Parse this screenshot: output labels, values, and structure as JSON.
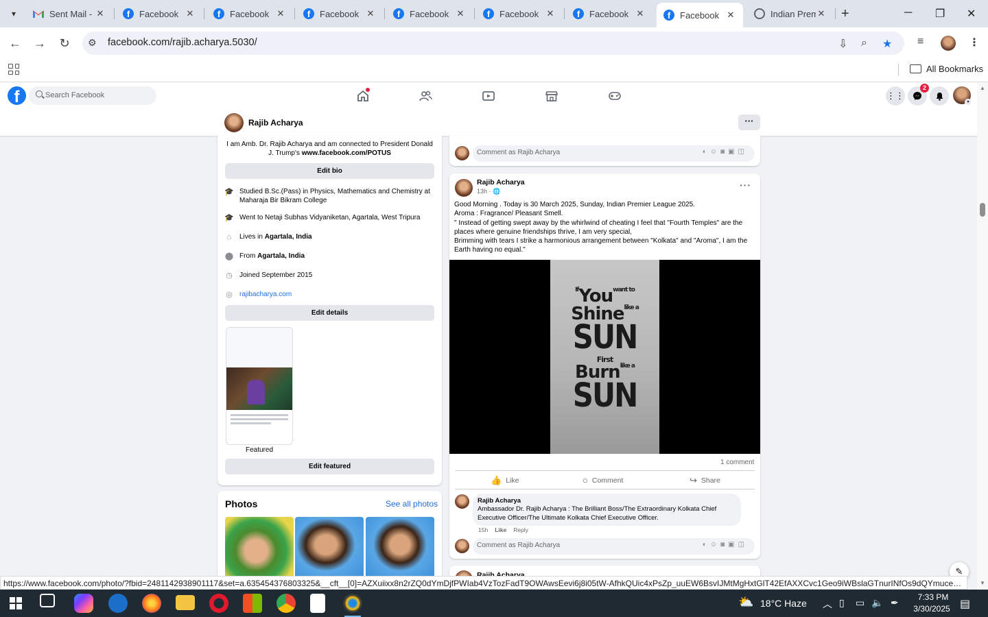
{
  "browser": {
    "tabs": [
      {
        "label": "Sent Mail -",
        "icon": "gmail-icon"
      },
      {
        "label": "Facebook",
        "icon": "facebook-icon"
      },
      {
        "label": "Facebook",
        "icon": "facebook-icon"
      },
      {
        "label": "Facebook",
        "icon": "facebook-icon"
      },
      {
        "label": "Facebook",
        "icon": "facebook-icon"
      },
      {
        "label": "Facebook",
        "icon": "facebook-icon"
      },
      {
        "label": "Facebook",
        "icon": "facebook-icon"
      },
      {
        "label": "Facebook",
        "icon": "facebook-icon",
        "active": true
      },
      {
        "label": "Indian Prem",
        "icon": "globe-icon"
      }
    ],
    "url": "facebook.com/rajib.acharya.5030/",
    "bookmarks_label": "All Bookmarks",
    "status_url": "https://www.facebook.com/photo/?fbid=2481142938901117&set=a.635454376803325&__cft__[0]=AZXuiixx8n2rZQ0dYmDjfPWIab4VzTozFadT9OWAwsEevi6j8i05tW-AfhkQUic4xPsZp_uuEW6BsvIJMtMgHxtGlT42EfAXXCvc1Geo9iWBslaGTnurINfOs9dQYmuceHP1Txh..."
  },
  "fb": {
    "search_placeholder": "Search Facebook",
    "messenger_badge": "2",
    "accent_color": "#1877f2"
  },
  "profile": {
    "name": "Rajib Acharya",
    "bio_line1": "I am Amb. Dr. Rajib Acharya and am connected to President Donald",
    "bio_line2_prefix": "J. Trump's ",
    "bio_line2_link": "www.facebook.com/POTUS",
    "edit_bio": "Edit bio",
    "details": [
      {
        "icon": "graduation-cap-icon",
        "text": "Studied B.Sc.(Pass) in Physics, Mathematics and Chemistry at Maharaja Bir Bikram College"
      },
      {
        "icon": "graduation-cap-icon",
        "text": "Went to Netaji Subhas Vidyaniketan, Agartala, West Tripura"
      },
      {
        "icon": "home-icon",
        "prefix": "Lives in ",
        "bold": "Agartala, India"
      },
      {
        "icon": "location-pin-icon",
        "prefix": "From ",
        "bold": "Agartala, India"
      },
      {
        "icon": "clock-icon",
        "text": "Joined September 2015"
      },
      {
        "icon": "globe-icon",
        "link": "rajibacharya.com"
      }
    ],
    "edit_details": "Edit details",
    "featured_label": "Featured",
    "edit_featured": "Edit featured",
    "photos_title": "Photos",
    "see_all_photos": "See all photos"
  },
  "comment_placeholder": "Comment as Rajib Acharya",
  "post": {
    "author": "Rajib Acharya",
    "time": "13h",
    "text": [
      "Good Morning . Today is 30 March 2025, Sunday, Indian Premier League 2025.",
      "Aroma : Fragrance/ Pleasant Smell.",
      "\" Instead of getting swept away by the whirlwind of cheating I feel that \"Fourth Temples\" are the places where genuine friendships thrive, I am very special,",
      "Brimming with tears I strike a harmonious arrangement between \"Kolkata\" and \"Aroma\", I am the Earth having no equal.\""
    ],
    "poster": {
      "if": "If",
      "you": "You",
      "want": "want",
      "to": "to",
      "shine": "Shine",
      "like1": "like",
      "a1": "a",
      "sun1": "SUN",
      "first": "First",
      "burn": "Burn",
      "like2": "like",
      "a2": "a",
      "sun2": "SUN"
    },
    "comments_count": "1 comment",
    "like": "Like",
    "comment": "Comment",
    "share": "Share",
    "comment_item": {
      "author": "Rajib Acharya",
      "text": "Ambassador Dr. Rajib Acharya : The Brilliant Boss/The Extraordinary Kolkata Chief Executive Officer/The Ultimate Kolkata Chief Executive Officer.",
      "time": "15h",
      "like": "Like",
      "reply": "Reply"
    },
    "next_author": "Rajib Acharya"
  },
  "taskbar": {
    "weather": "18°C  Haze",
    "time": "7:33 PM",
    "date": "3/30/2025"
  }
}
